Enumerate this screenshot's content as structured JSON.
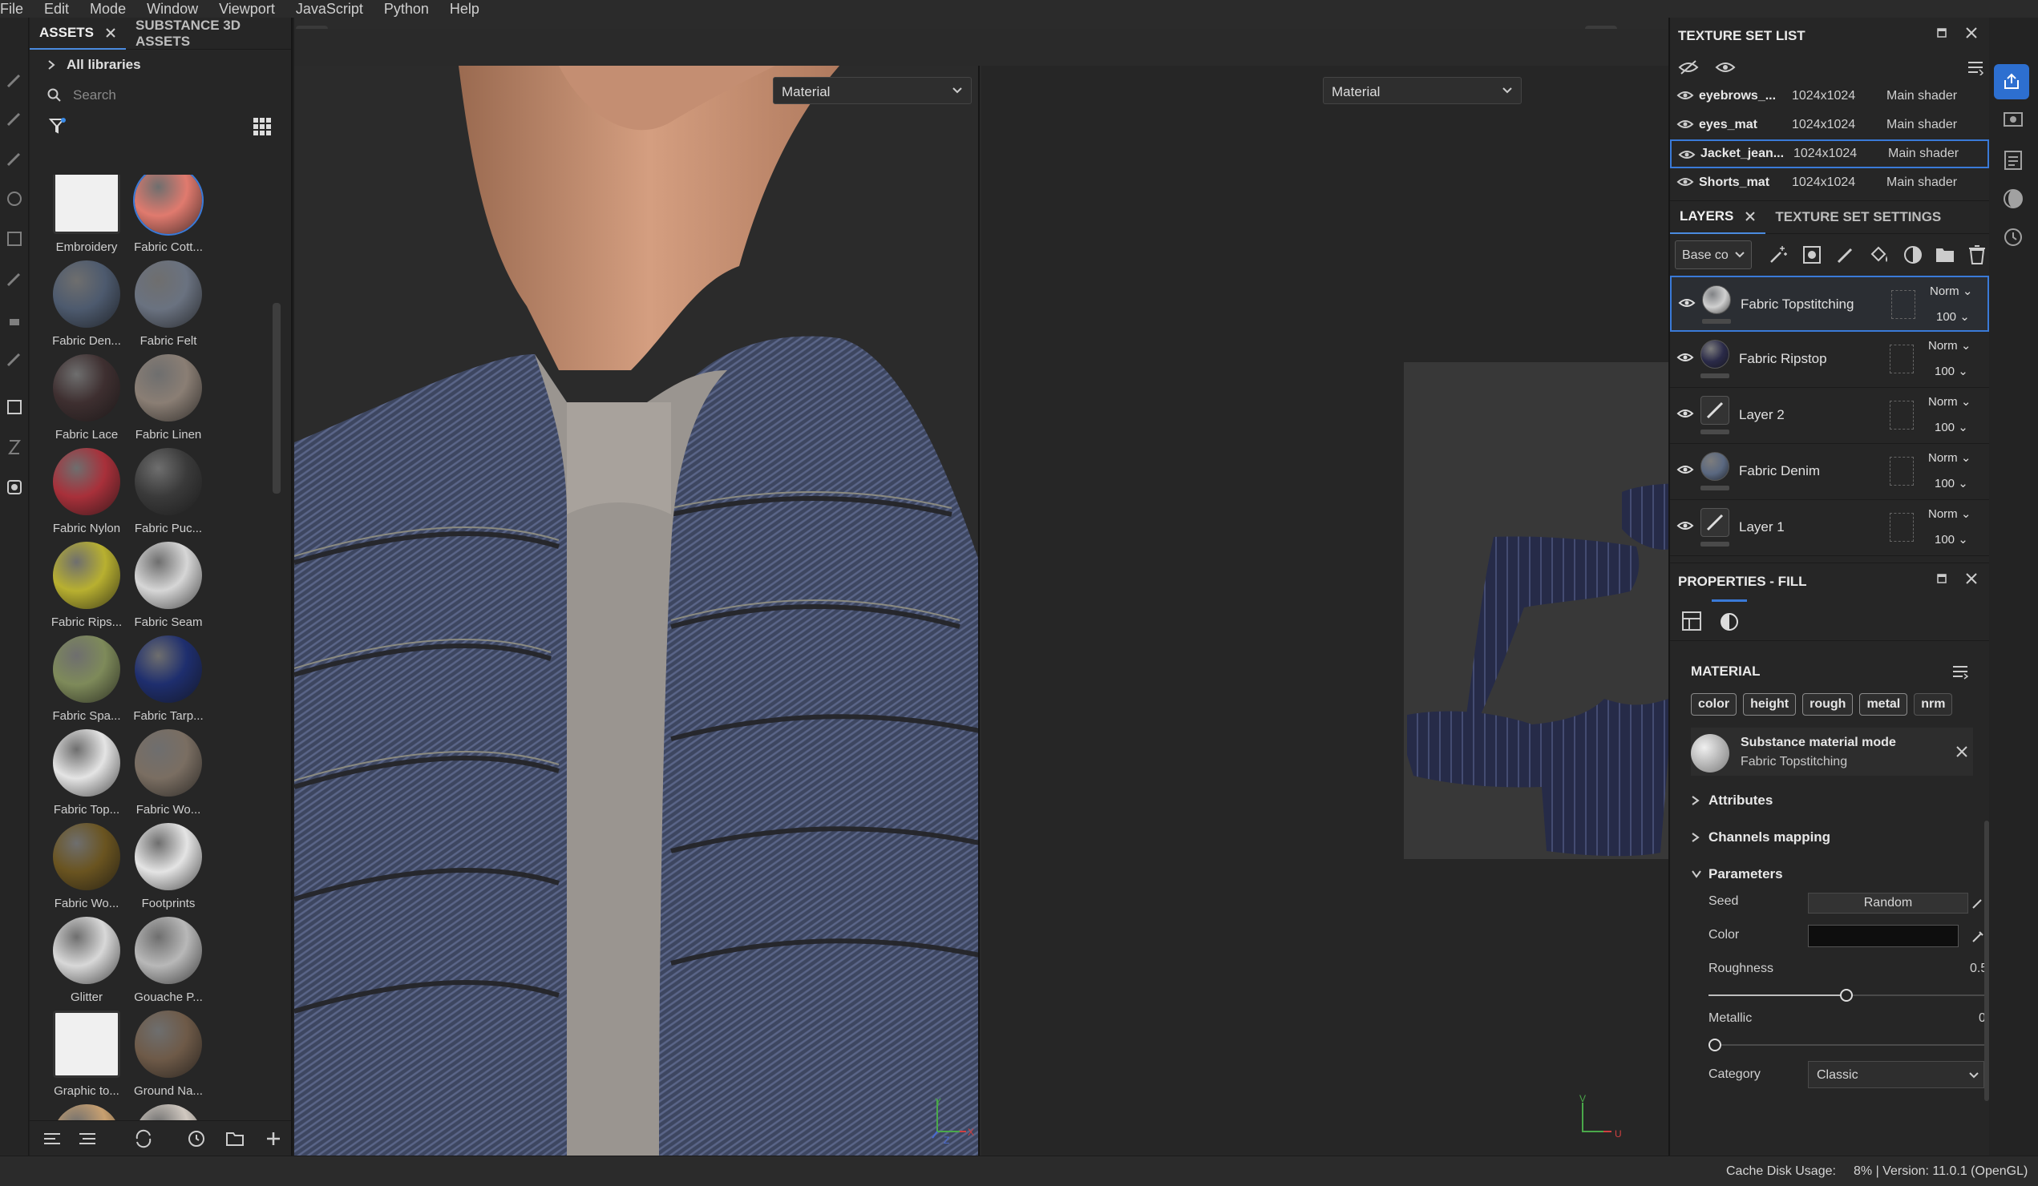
{
  "menu": [
    "File",
    "Edit",
    "Mode",
    "Window",
    "Viewport",
    "JavaScript",
    "Python",
    "Help"
  ],
  "assets_panel": {
    "tab_assets": "ASSETS",
    "tab_substance": "SUBSTANCE 3D ASSETS",
    "all_libraries": "All libraries",
    "search_placeholder": "Search",
    "items": [
      {
        "label": "Embroidery",
        "color": "#d8d8d8",
        "icon": "embroidery-icon"
      },
      {
        "label": "Fabric Cott...",
        "color": "#e07a6e",
        "selected": true
      },
      {
        "label": "Fabric Den...",
        "color": "#4d5a6e"
      },
      {
        "label": "Fabric Felt",
        "color": "#6a7280"
      },
      {
        "label": "Fabric Lace",
        "color": "#3e2f30"
      },
      {
        "label": "Fabric Linen",
        "color": "#8a7e74"
      },
      {
        "label": "Fabric Nylon",
        "color": "#a8303a"
      },
      {
        "label": "Fabric Puc...",
        "color": "#3a3a3a"
      },
      {
        "label": "Fabric Rips...",
        "color": "#b8b030"
      },
      {
        "label": "Fabric Seam",
        "color": "#d6d6d6"
      },
      {
        "label": "Fabric Spa...",
        "color": "#7e8a5a"
      },
      {
        "label": "Fabric Tarp...",
        "color": "#1e2e6e"
      },
      {
        "label": "Fabric Top...",
        "color": "#e4e4e4"
      },
      {
        "label": "Fabric Wo...",
        "color": "#7a6e62"
      },
      {
        "label": "Fabric Wo...",
        "color": "#6a5420"
      },
      {
        "label": "Footprints",
        "color": "#e4e4e4"
      },
      {
        "label": "Glitter",
        "color": "#d8d8d8"
      },
      {
        "label": "Gouache P...",
        "color": "#b8b8b8"
      },
      {
        "label": "Graphic to...",
        "color": "#dcdcdc",
        "icon": "graphic-tool-icon"
      },
      {
        "label": "Ground Na...",
        "color": "#6e5a48"
      },
      {
        "label": "",
        "color": "#c8a070"
      },
      {
        "label": "",
        "color": "#d0c8c0"
      }
    ]
  },
  "viewport": {
    "material_left": "Material",
    "material_right": "Material",
    "axis_3d_y": "Y",
    "axis_3d_x": "X",
    "axis_3d_z": "Z",
    "axis_2d_v": "V",
    "axis_2d_u": "U"
  },
  "texture_set_list": {
    "title": "TEXTURE SET LIST",
    "rows": [
      {
        "name": "eyebrows_...",
        "res": "1024x1024",
        "shader": "Main shader"
      },
      {
        "name": "eyes_mat",
        "res": "1024x1024",
        "shader": "Main shader"
      },
      {
        "name": "Jacket_jean...",
        "res": "1024x1024",
        "shader": "Main shader",
        "selected": true
      },
      {
        "name": "Shorts_mat",
        "res": "1024x1024",
        "shader": "Main shader"
      }
    ]
  },
  "layers": {
    "tab_layers": "LAYERS",
    "tab_settings": "TEXTURE SET SETTINGS",
    "channel": "Base co",
    "rows": [
      {
        "name": "Fabric Topstitching",
        "blend": "Norm",
        "opacity": "100",
        "thumb": "#d0d0d0",
        "selected": true
      },
      {
        "name": "Fabric Ripstop",
        "blend": "Norm",
        "opacity": "100",
        "thumb": "#2a2a48"
      },
      {
        "name": "Layer 2",
        "blend": "Norm",
        "opacity": "100",
        "thumb": "brush"
      },
      {
        "name": "Fabric Denim",
        "blend": "Norm",
        "opacity": "100",
        "thumb": "#5a6880"
      },
      {
        "name": "Layer 1",
        "blend": "Norm",
        "opacity": "100",
        "thumb": "brush"
      }
    ]
  },
  "properties": {
    "title": "PROPERTIES - FILL",
    "material_header": "MATERIAL",
    "chips": [
      "color",
      "height",
      "rough",
      "metal",
      "nrm"
    ],
    "mode_title": "Substance material mode",
    "mode_sub": "Fabric Topstitching",
    "attributes": "Attributes",
    "channels_mapping": "Channels mapping",
    "parameters": "Parameters",
    "seed_label": "Seed",
    "seed_value": "Random",
    "color_label": "Color",
    "roughness_label": "Roughness",
    "roughness_value": "0.5",
    "metallic_label": "Metallic",
    "metallic_value": "0",
    "category_label": "Category",
    "category_value": "Classic"
  },
  "status": {
    "cache": "Cache Disk Usage:",
    "info": "8% | Version: 11.0.1 (OpenGL)"
  }
}
